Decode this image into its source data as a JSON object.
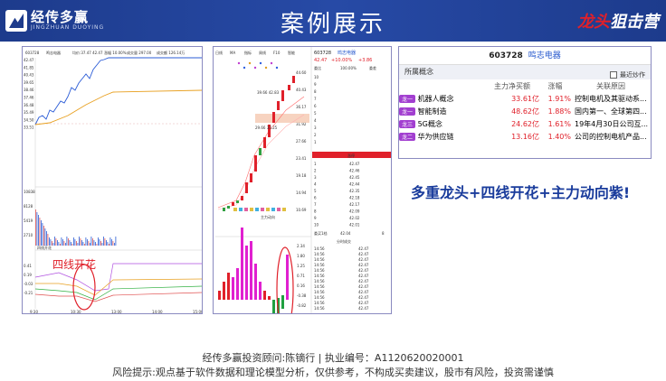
{
  "header": {
    "logo_cn": "经传多赢",
    "logo_en": "JINGZHUAN DUOYING",
    "title": "案例展示",
    "brand_prefix": "龙头",
    "brand_suffix": "狙击营"
  },
  "intraday": {
    "code": "603728",
    "name": "鸣志电器",
    "info": [
      "均价:37.47 42.47",
      "涨幅 10.00%",
      "成交量 297.00",
      "成交额 126.14万"
    ],
    "price_ticks": [
      "42.47",
      "41.85",
      "40.43",
      "39.65",
      "38.46",
      "37.46",
      "36.48",
      "35.49",
      "34.50",
      "33.51"
    ],
    "time_ticks": [
      "9:30",
      "10:30",
      "13:00",
      "14:00",
      "15:00"
    ],
    "vol_ticks": [
      "10838",
      "8128",
      "5419",
      "2710"
    ],
    "indicator_legend": "四线开花",
    "indicator_ticks": [
      "0.41",
      "0.19",
      "-0.03",
      "-0.21"
    ],
    "annotation": "四线开花"
  },
  "daily": {
    "toolbar": [
      "日线",
      "MA",
      "指标",
      "周线",
      "F10",
      "智能"
    ],
    "price_ticks": [
      "44.60",
      "40.43",
      "36.17",
      "31.92",
      "27.66",
      "23.41",
      "19.18",
      "14.94",
      "10.69"
    ],
    "ma_label": "39.66 42.83",
    "ma_label2": "29.66 33.25",
    "indicator_name": "主力动向",
    "indicator_ticks": [
      "2.34",
      "1.80",
      "1.25",
      "0.71",
      "0.16",
      "-0.38",
      "-0.82"
    ]
  },
  "quote": {
    "code": "603728",
    "name": "鸣志电器",
    "price": "42.47",
    "change": "+10.00%",
    "change_abs": "+3.86",
    "header": [
      "委比",
      "100.00%",
      "委差"
    ],
    "limit_label": "涨停",
    "sell_rows": [
      "10",
      "9",
      "8",
      "7",
      "6",
      "5",
      "4",
      "3",
      "2",
      "1"
    ],
    "buy_rows": [
      [
        "1",
        "42.47"
      ],
      [
        "2",
        "42.46"
      ],
      [
        "3",
        "42.45"
      ],
      [
        "4",
        "42.44"
      ],
      [
        "5",
        "42.35"
      ],
      [
        "6",
        "42.18"
      ],
      [
        "7",
        "42.17"
      ],
      [
        "8",
        "42.09"
      ],
      [
        "9",
        "42.02"
      ],
      [
        "10",
        "42.01"
      ]
    ],
    "buy_total": [
      "委买1档",
      "42.04",
      "8"
    ],
    "trades_title": "分时成交",
    "trades": [
      [
        "14:56",
        "42.47"
      ],
      [
        "14:56",
        "42.47"
      ],
      [
        "14:56",
        "42.47"
      ],
      [
        "14:56",
        "42.47"
      ],
      [
        "14:56",
        "42.47"
      ],
      [
        "14:56",
        "42.47"
      ],
      [
        "14:56",
        "42.47"
      ],
      [
        "14:56",
        "42.47"
      ],
      [
        "14:56",
        "42.47"
      ],
      [
        "14:56",
        "42.47"
      ],
      [
        "14:56",
        "42.47"
      ],
      [
        "14:56",
        "42.47"
      ]
    ]
  },
  "concepts": {
    "code": "603728",
    "name": "鸣志电器",
    "section": "所属概念",
    "checkbox_label": "最近炒作",
    "columns": [
      "主力净买额",
      "涨幅",
      "关联原因"
    ],
    "rows": [
      {
        "tag": "龙一",
        "name": "机器人概念",
        "amount": "33.61亿",
        "pct": "1.91%",
        "reason": "控制电机及其驱动系..."
      },
      {
        "tag": "龙一",
        "name": "智能制造",
        "amount": "48.62亿",
        "pct": "1.88%",
        "reason": "国内第一、全球第四..."
      },
      {
        "tag": "龙三",
        "name": "5G概念",
        "amount": "24.62亿",
        "pct": "1.61%",
        "reason": "19年4月30日公司互..."
      },
      {
        "tag": "龙二",
        "name": "华为供应链",
        "amount": "13.16亿",
        "pct": "1.40%",
        "reason": "公司的控制电机产品..."
      }
    ],
    "tag_color": "#a23fd0"
  },
  "slogan": "多重龙头+四线开花+主力动向紫!",
  "footer": {
    "line1": "经传多赢投资顾问:陈镝行 | 执业编号：A1120620020001",
    "line2": "风险提示:观点基于软件数据和理论模型分析，仅供参考，不构成买卖建议，股市有风险，投资需谨慎"
  }
}
